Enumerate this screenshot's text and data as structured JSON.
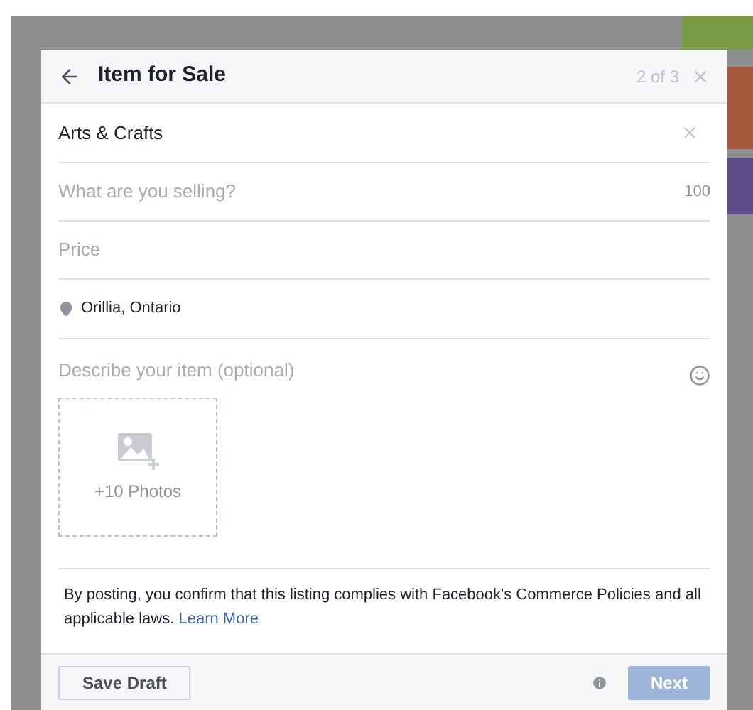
{
  "dialog": {
    "title": "Item for Sale",
    "step": "2 of 3"
  },
  "category": {
    "value": "Arts & Crafts"
  },
  "title_field": {
    "placeholder": "What are you selling?",
    "counter": "100"
  },
  "price_field": {
    "placeholder": "Price"
  },
  "location": {
    "value": "Orillia, Ontario"
  },
  "description_field": {
    "placeholder": "Describe your item (optional)"
  },
  "photos": {
    "label": "+10 Photos"
  },
  "notice": {
    "text": "By posting, you confirm that this listing complies with Facebook's Commerce Policies and all applicable laws.",
    "link": "Learn More"
  },
  "footer": {
    "save_button": "Save Draft",
    "next_button": {
      "label": "Next",
      "disabled": true
    }
  }
}
